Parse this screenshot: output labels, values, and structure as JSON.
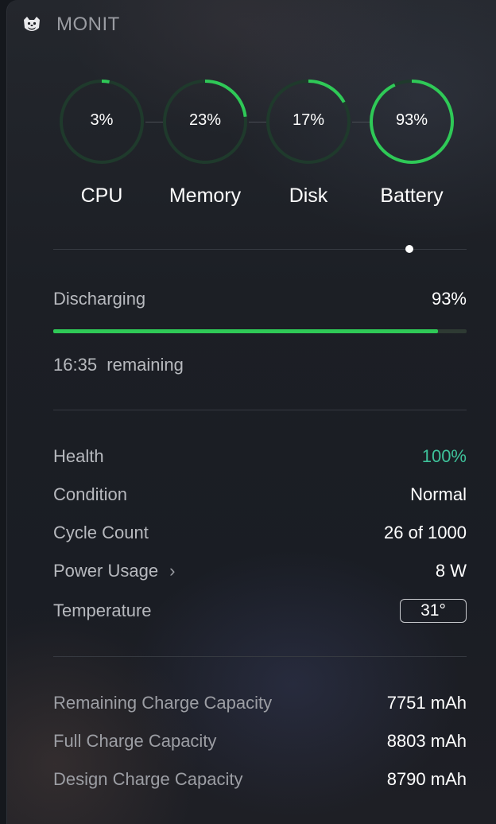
{
  "app": {
    "title": "MONIT"
  },
  "gauges": [
    {
      "label": "CPU",
      "value": "3%",
      "fraction": 0.03,
      "color": "#2fc957"
    },
    {
      "label": "Memory",
      "value": "23%",
      "fraction": 0.23,
      "color": "#2fc957"
    },
    {
      "label": "Disk",
      "value": "17%",
      "fraction": 0.17,
      "color": "#2fc957"
    },
    {
      "label": "Battery",
      "value": "93%",
      "fraction": 0.93,
      "color": "#2fc957"
    }
  ],
  "battery": {
    "status": "Discharging",
    "percent": "93%",
    "level": 0.93,
    "time_remaining": "16:35",
    "remaining_label": "remaining"
  },
  "details": {
    "health_label": "Health",
    "health_value": "100%",
    "condition_label": "Condition",
    "condition_value": "Normal",
    "cycle_label": "Cycle Count",
    "cycle_value": "26 of 1000",
    "power_label": "Power Usage",
    "power_value": "8 W",
    "temp_label": "Temperature",
    "temp_value": "31°"
  },
  "capacity": {
    "remaining_label": "Remaining Charge Capacity",
    "remaining_value": "7751 mAh",
    "full_label": "Full Charge Capacity",
    "full_value": "8803 mAh",
    "design_label": "Design Charge Capacity",
    "design_value": "8790 mAh"
  },
  "colors": {
    "accent_green": "#2fc957",
    "health_green": "#3ec29a"
  }
}
